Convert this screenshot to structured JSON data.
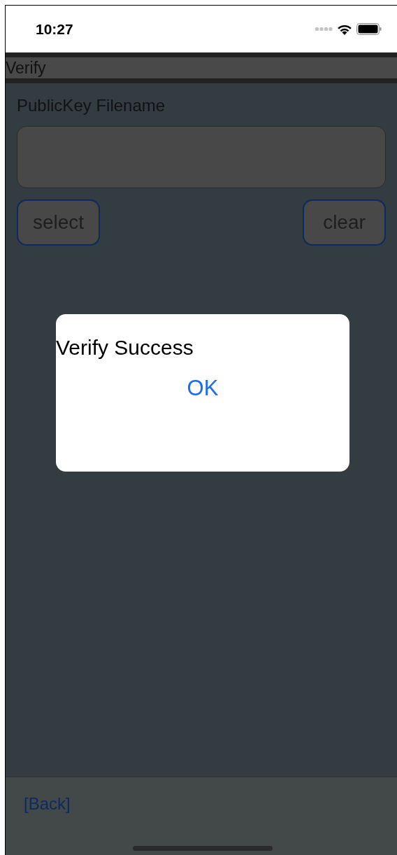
{
  "status_bar": {
    "time": "10:27"
  },
  "title_bar": {
    "title": "Verify"
  },
  "form": {
    "label": "PublicKey Filename",
    "buttons": [
      {
        "label": "select"
      },
      {
        "label": "clear"
      }
    ]
  },
  "dialog": {
    "message": "Verify Success",
    "button": "OK"
  },
  "bottom_bar": {
    "back_link": "[Back]"
  }
}
